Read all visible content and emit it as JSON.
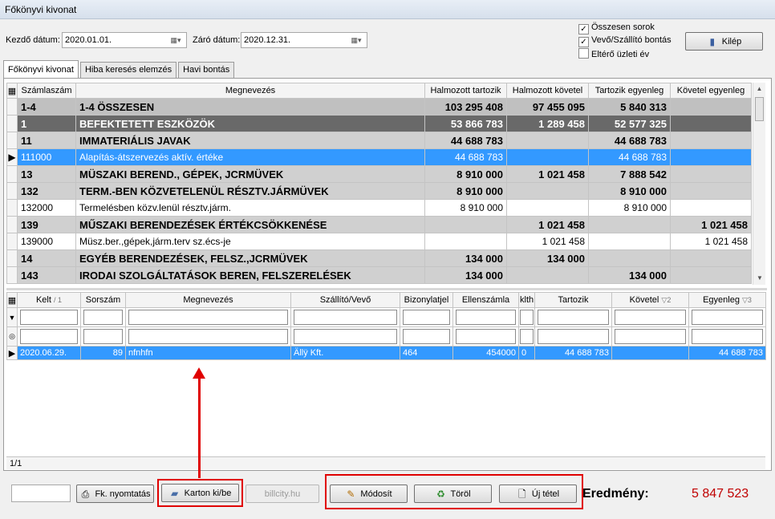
{
  "window": {
    "title": "Főkönyvi kivonat"
  },
  "filters": {
    "start_label": "Kezdő dátum:",
    "start_value": "2020.01.01.",
    "end_label": "Záró dátum:",
    "end_value": "2020.12.31."
  },
  "options": [
    {
      "label": "Összesen sorok",
      "checked": true
    },
    {
      "label": "Vevő/Szállító bontás",
      "checked": true
    },
    {
      "label": "Eltérő üzleti év",
      "checked": false
    }
  ],
  "exit_label": "Kilép",
  "tabs": [
    "Főkönyvi kivonat",
    "Hiba keresés elemzés",
    "Havi bontás"
  ],
  "grid1": {
    "columns": [
      "Számlaszám",
      "Megnevezés",
      "Halmozott tartozik",
      "Halmozott követel",
      "Tartozik egyenleg",
      "Követel egyenleg"
    ],
    "rows": [
      {
        "acc": "1-4",
        "name": "1-4 ÖSSZESEN",
        "t": "103 295 408",
        "k": "97 455 095",
        "te": "5 840 313",
        "ke": ""
      },
      {
        "acc": "1",
        "name": "BEFEKTETETT ESZKÖZÖK",
        "t": "53 866 783",
        "k": "1 289 458",
        "te": "52 577 325",
        "ke": ""
      },
      {
        "acc": "11",
        "name": "IMMATERIÁLIS JAVAK",
        "t": "44 688 783",
        "k": "",
        "te": "44 688 783",
        "ke": ""
      },
      {
        "acc": "111000",
        "name": "Alapítás-átszervezés aktív. értéke",
        "t": "44 688 783",
        "k": "",
        "te": "44 688 783",
        "ke": ""
      },
      {
        "acc": "13",
        "name": "MÜSZAKI BEREND., GÉPEK, JCRMÜVEK",
        "t": "8 910 000",
        "k": "1 021 458",
        "te": "7 888 542",
        "ke": ""
      },
      {
        "acc": "132",
        "name": "TERM.-BEN KÖZVETELENÜL RÉSZTV.JÁRMÜVEK",
        "t": "8 910 000",
        "k": "",
        "te": "8 910 000",
        "ke": ""
      },
      {
        "acc": "132000",
        "name": "Termelésben közv.lenül résztv.járm.",
        "t": "8 910 000",
        "k": "",
        "te": "8 910 000",
        "ke": ""
      },
      {
        "acc": "139",
        "name": "MŰSZAKI BERENDEZÉSEK ÉRTÉKCSÖKKENÉSE",
        "t": "",
        "k": "1 021 458",
        "te": "",
        "ke": "1 021 458"
      },
      {
        "acc": "139000",
        "name": "Müsz.ber.,gépek,járm.terv sz.écs-je",
        "t": "",
        "k": "1 021 458",
        "te": "",
        "ke": "1 021 458"
      },
      {
        "acc": "14",
        "name": "EGYÉB BERENDEZÉSEK, FELSZ.,JCRMÜVEK",
        "t": "134 000",
        "k": "134 000",
        "te": "",
        "ke": ""
      },
      {
        "acc": "143",
        "name": "IRODAI SZOLGÁLTATÁSOK BEREN, FELSZERELÉSEK",
        "t": "134 000",
        "k": "",
        "te": "134 000",
        "ke": ""
      }
    ]
  },
  "grid2": {
    "columns": [
      "Kelt",
      "Sorszám",
      "Megnevezés",
      "Szállító/Vevő",
      "Bizonylatjel",
      "Ellenszámla",
      "klth",
      "Tartozik",
      "Követel",
      "Egyenleg"
    ],
    "sort_marks": {
      "kelt": "/ 1",
      "kovetel": "▽2",
      "egyenleg": "▽3"
    },
    "row": {
      "kelt": "2020.06.29.",
      "sorszam": "89",
      "megnevezes": "nfnhfn",
      "szallito": "Ällÿ Kft.",
      "bizonylat": "464",
      "ellenszamla": "454000",
      "klth": "0",
      "tartozik": "44 688 783",
      "kovetel": "",
      "egyenleg": "44 688 783"
    },
    "footer": "1/1"
  },
  "bottom": {
    "print_label": "Fk. nyomtatás",
    "karton_label": "Karton ki/be",
    "billcity_label": "billcity.hu",
    "modify_label": "Módosít",
    "delete_label": "Töröl",
    "new_label": "Új tétel",
    "result_label": "Eredmény:",
    "result_value": "5 847 523"
  },
  "colors": {
    "selection": "#3399ff",
    "highlight": "#e00000",
    "result": "#c00000"
  }
}
